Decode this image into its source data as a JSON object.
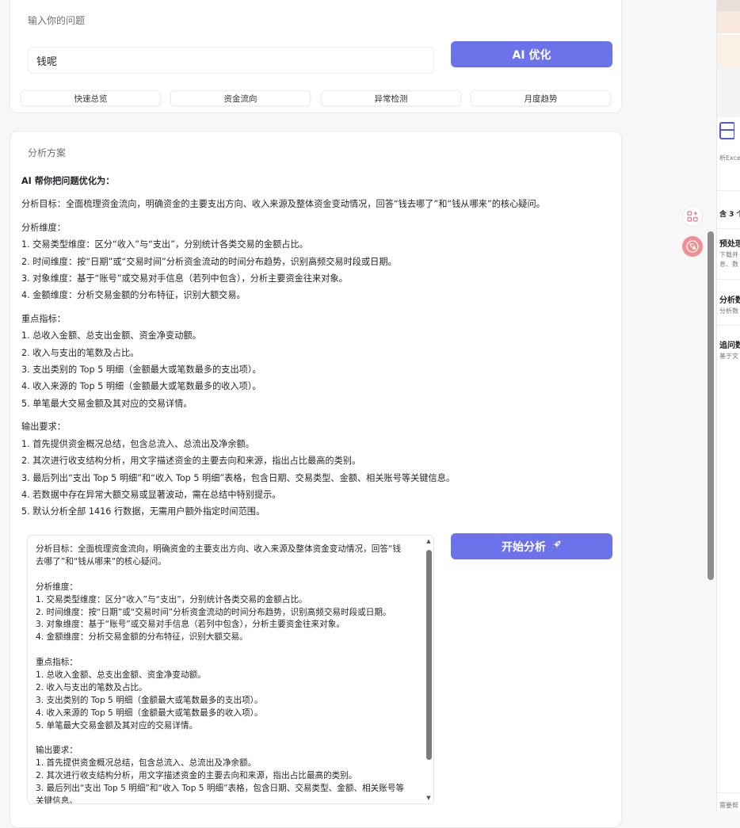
{
  "input_section": {
    "label": "输入你的问题",
    "question_value": "钱呢",
    "ai_optimize_label": "AI 优化",
    "quick_actions": [
      "快速总览",
      "资金流向",
      "异常检测",
      "月度趋势"
    ]
  },
  "plan_section": {
    "label": "分析方案",
    "heading": "AI 帮你把问题优化为：",
    "goal": "分析目标：全面梳理资金流向，明确资金的主要支出方向、收入来源及整体资金变动情况，回答“钱去哪了”和“钱从哪来”的核心疑问。",
    "dimensions_title": "分析维度：",
    "dimensions": [
      "1. 交易类型维度：区分“收入”与“支出”，分别统计各类交易的金额占比。",
      "2. 时间维度：按“日期”或“交易时间”分析资金流动的时间分布趋势，识别高频交易时段或日期。",
      "3. 对象维度：基于“账号”或交易对手信息（若列中包含），分析主要资金往来对象。",
      "4. 金额维度：分析交易金额的分布特征，识别大额交易。"
    ],
    "metrics_title": "重点指标：",
    "metrics": [
      "1. 总收入金额、总支出金额、资金净变动额。",
      "2. 收入与支出的笔数及占比。",
      "3. 支出类别的 Top 5 明细（金额最大或笔数最多的支出项）。",
      "4. 收入来源的 Top 5 明细（金额最大或笔数最多的收入项）。",
      "5. 单笔最大交易金额及其对应的交易详情。"
    ],
    "output_title": "输出要求：",
    "outputs": [
      "1. 首先提供资金概况总结，包含总流入、总流出及净余额。",
      "2. 其次进行收支结构分析，用文字描述资金的主要去向和来源，指出占比最高的类别。",
      "3. 最后列出“支出 Top 5 明细”和“收入 Top 5 明细”表格，包含日期、交易类型、金额、相关账号等关键信息。",
      "4. 若数据中存在异常大额交易或显著波动，需在总结中特别提示。",
      "5. 默认分析全部 1416 行数据，无需用户额外指定时间范围。"
    ],
    "editor": {
      "goal": "分析目标：全面梳理资金流向，明确资金的主要支出方向、收入来源及整体资金变动情况，回答“钱去哪了”和“钱从哪来”的核心疑问。",
      "dimensions_title": "分析维度：",
      "dimensions": [
        "1. 交易类型维度：区分“收入”与“支出”，分别统计各类交易的金额占比。",
        "2. 时间维度：按“日期”或“交易时间”分析资金流动的时间分布趋势，识别高频交易时段或日期。",
        "3. 对象维度：基于“账号”或交易对手信息（若列中包含），分析主要资金往来对象。",
        "4. 金额维度：分析交易金额的分布特征，识别大额交易。"
      ],
      "metrics_title": "重点指标：",
      "metrics": [
        "1. 总收入金额、总支出金额、资金净变动额。",
        "2. 收入与支出的笔数及占比。",
        "3. 支出类别的 Top 5 明细（金额最大或笔数最多的支出项）。",
        "4. 收入来源的 Top 5 明细（金额最大或笔数最多的收入项）。",
        "5. 单笔最大交易金额及其对应的交易详情。"
      ],
      "output_title": "输出要求：",
      "outputs": [
        "1. 首先提供资金概况总结，包含总流入、总流出及净余额。",
        "2. 其次进行收支结构分析，用文字描述资金的主要去向和来源，指出占比最高的类别。",
        "3. 最后列出“支出 Top 5 明细”和“收入 Top 5 明细”表格，包含日期、交易类型、金额、相关账号等关键信息。"
      ]
    },
    "start_label": "开始分析",
    "start_icon": "rocket-icon"
  },
  "side_panel": {
    "excel_label": "析Excel",
    "count_label": "含 3 个",
    "items": [
      {
        "title": "预处理",
        "line1": "下载并",
        "line2": "息、数"
      },
      {
        "title": "分析数",
        "line1": "分析数"
      },
      {
        "title": "追问数",
        "line1": "基于文"
      }
    ],
    "footer": "需要帮"
  },
  "colors": {
    "primary": "#6b72ea",
    "translate": "#ee8f94",
    "background": "#f7f7f8"
  }
}
